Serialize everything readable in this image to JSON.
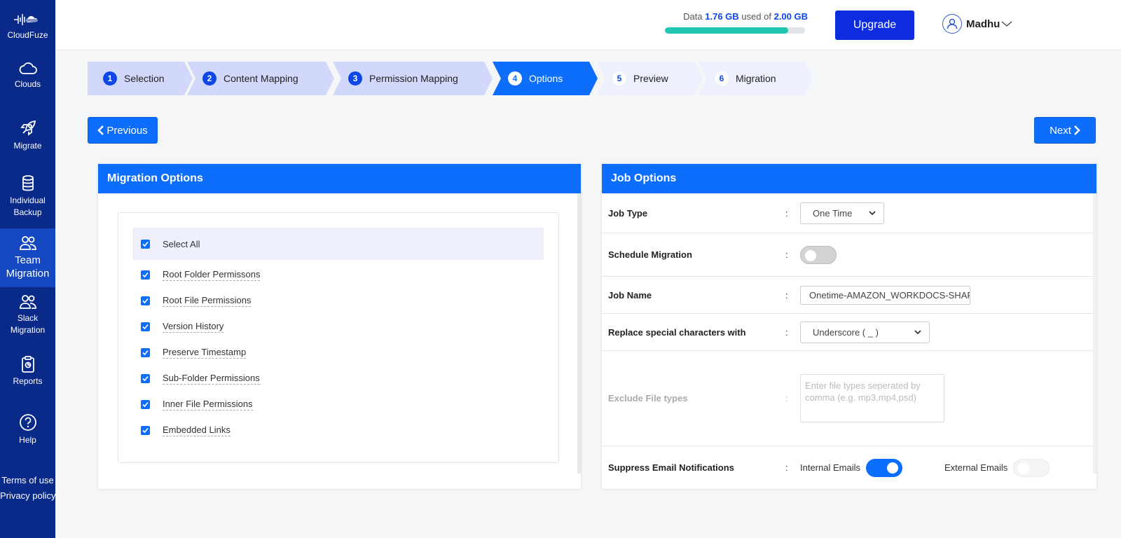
{
  "sidebar": {
    "brand": "CloudFuze",
    "items": [
      {
        "label": "Clouds",
        "icon": "cloud-icon"
      },
      {
        "label": "Migrate",
        "icon": "rocket-icon"
      },
      {
        "label": "Individual Backup",
        "icon": "database-icon"
      },
      {
        "label": "Team Migration",
        "icon": "users-icon",
        "active": true
      },
      {
        "label": "Slack Migration",
        "icon": "users-icon"
      },
      {
        "label": "Reports",
        "icon": "clipboard-icon"
      },
      {
        "label": "Help",
        "icon": "help-circle-icon"
      }
    ],
    "footer": {
      "terms": "Terms of use",
      "privacy": "Privacy policy"
    }
  },
  "header": {
    "usage": {
      "prefix": "Data",
      "used": "1.76 GB",
      "mid": "used of",
      "total": "2.00 GB",
      "fraction": 0.88
    },
    "upgrade_label": "Upgrade",
    "user_name": "Madhu"
  },
  "stepper": {
    "steps": [
      {
        "num": "1",
        "label": "Selection",
        "state": "done"
      },
      {
        "num": "2",
        "label": "Content Mapping",
        "state": "done"
      },
      {
        "num": "3",
        "label": "Permission Mapping",
        "state": "done"
      },
      {
        "num": "4",
        "label": "Options",
        "state": "active"
      },
      {
        "num": "5",
        "label": "Preview",
        "state": "todo"
      },
      {
        "num": "6",
        "label": "Migration",
        "state": "todo"
      }
    ]
  },
  "nav": {
    "previous_label": "Previous",
    "next_label": "Next"
  },
  "migration_options": {
    "title": "Migration Options",
    "select_all": "Select All",
    "options": [
      {
        "label": "Root Folder Permissons",
        "checked": true
      },
      {
        "label": "Root File Permissions",
        "checked": true
      },
      {
        "label": "Version History",
        "checked": true
      },
      {
        "label": "Preserve Timestamp",
        "checked": true
      },
      {
        "label": "Sub-Folder Permissions",
        "checked": true
      },
      {
        "label": "Inner File Permissions",
        "checked": true
      },
      {
        "label": "Embedded Links",
        "checked": true
      }
    ]
  },
  "job_options": {
    "title": "Job Options",
    "colon": ":",
    "job_type": {
      "label": "Job Type",
      "value": "One Time"
    },
    "schedule": {
      "label": "Schedule Migration",
      "on": false
    },
    "job_name": {
      "label": "Job Name",
      "value": "Onetime-AMAZON_WORKDOCS-SHAREPOINT"
    },
    "replace_chars": {
      "label": "Replace special characters with",
      "value": "Underscore ( _ )"
    },
    "exclude": {
      "label": "Exclude File types",
      "placeholder": "Enter file types seperated by comma (e.g. mp3,mp4,psd)"
    },
    "suppress": {
      "label": "Suppress Email Notifications",
      "internal": {
        "label": "Internal Emails",
        "on": true
      },
      "external": {
        "label": "External Emails",
        "on": false
      }
    }
  }
}
